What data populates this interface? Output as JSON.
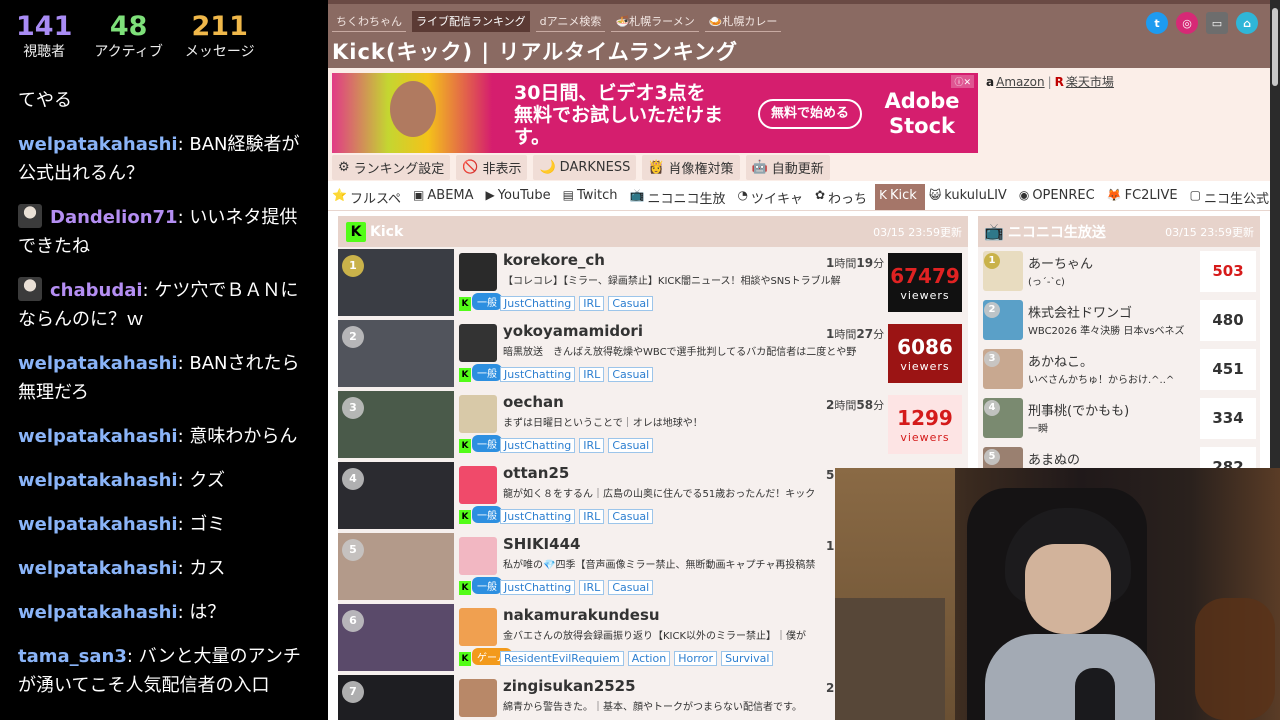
{
  "stream_stats": {
    "viewers": {
      "value": "141",
      "label": "視聴者"
    },
    "active": {
      "value": "48",
      "label": "アクティブ"
    },
    "messages": {
      "value": "211",
      "label": "メッセージ"
    }
  },
  "chat_messages": [
    {
      "user": "",
      "text": "てやる",
      "user_color": "#ffffff",
      "avatar": false
    },
    {
      "user": "welpatakahashi",
      "text": ": BAN経験者が公式出れるん？",
      "user_color": "#8ab4f8",
      "avatar": false
    },
    {
      "user": "Dandelion71",
      "text": ": いいネタ提供できたね",
      "user_color": "#b48ef2",
      "avatar": true
    },
    {
      "user": "chabudai",
      "text": ": ケツ穴でＢＡＮにならんのに？ｗ",
      "user_color": "#b48ef2",
      "avatar": true
    },
    {
      "user": "welpatakahashi",
      "text": ": BANされたら無理だろ",
      "user_color": "#8ab4f8",
      "avatar": false
    },
    {
      "user": "welpatakahashi",
      "text": ": 意味わからん",
      "user_color": "#8ab4f8",
      "avatar": false
    },
    {
      "user": "welpatakahashi",
      "text": ": クズ",
      "user_color": "#8ab4f8",
      "avatar": false
    },
    {
      "user": "welpatakahashi",
      "text": ": ゴミ",
      "user_color": "#8ab4f8",
      "avatar": false
    },
    {
      "user": "welpatakahashi",
      "text": ": カス",
      "user_color": "#8ab4f8",
      "avatar": false
    },
    {
      "user": "welpatakahashi",
      "text": ": は？",
      "user_color": "#8ab4f8",
      "avatar": false
    },
    {
      "user": "tama_san3",
      "text": ": バンと大量のアンチが湧いてこそ人気配信者の入口",
      "user_color": "#8ab4f8",
      "avatar": false
    }
  ],
  "site": {
    "top_links": [
      "ちくわちゃん",
      "ライブ配信ランキング",
      "dアニメ検索",
      "🍜札幌ラーメン",
      "🍛札幌カレー"
    ],
    "active_top_link": 1,
    "title": "Kick(キック) | リアルタイムランキング"
  },
  "ad": {
    "headline": "30日間、ビデオ3点を無料でお試しいただけます。",
    "button": "無料で始める",
    "brand": "Adobe Stock"
  },
  "shop_links": {
    "amazon": "Amazon",
    "separator": "|",
    "rakuten": "楽天市場"
  },
  "toolbar": [
    {
      "icon": "⚙",
      "label": "ランキング設定",
      "icon_name": "gear-icon"
    },
    {
      "icon": "🚫",
      "label": "非表示",
      "icon_name": "prohibited-icon"
    },
    {
      "icon": "🌙",
      "label": "DARKNESS",
      "icon_name": "moon-icon"
    },
    {
      "icon": "👸",
      "label": "肖像権対策",
      "icon_name": "portrait-icon"
    },
    {
      "icon": "🤖",
      "label": "自動更新",
      "icon_name": "robot-icon"
    }
  ],
  "platform_tabs": [
    {
      "icon": "⭐",
      "label": "フルスペ"
    },
    {
      "icon": "▣",
      "label": "ABEMA"
    },
    {
      "icon": "▶",
      "label": "YouTube"
    },
    {
      "icon": "▤",
      "label": "Twitch"
    },
    {
      "icon": "📺",
      "label": "ニコニコ生放"
    },
    {
      "icon": "◔",
      "label": "ツイキャ"
    },
    {
      "icon": "✿",
      "label": "わっち"
    },
    {
      "icon": "K",
      "label": "Kick"
    },
    {
      "icon": "😺",
      "label": "kukuluLIV"
    },
    {
      "icon": "◉",
      "label": "OPENREC"
    },
    {
      "icon": "🦊",
      "label": "FC2LIVE"
    },
    {
      "icon": "▢",
      "label": "ニコ生公式"
    }
  ],
  "active_tab": 7,
  "kick_panel": {
    "title": "Kick",
    "updated": "03/15 23:59更新",
    "rows": [
      {
        "rank": "1",
        "name": "korekore_ch",
        "title": "【コレコレ】【ミラー、録画禁止】KICK闇ニュース！相談やSNSトラブル解",
        "duration_h": "1",
        "duration_label_h": "時間",
        "duration_m": "19",
        "duration_label_m": "分",
        "category": "一般",
        "tags": [
          "JustChatting",
          "IRL",
          "Casual"
        ],
        "viewers": "67479",
        "viewer_label": "viewers"
      },
      {
        "rank": "2",
        "name": "yokoyamamidori",
        "title": "暗黒放送　きんばえ放得乾燥やWBCで選手批判してるバカ配信者は二度とや野",
        "duration_h": "1",
        "duration_label_h": "時間",
        "duration_m": "27",
        "duration_label_m": "分",
        "category": "一般",
        "tags": [
          "JustChatting",
          "IRL",
          "Casual"
        ],
        "viewers": "6086",
        "viewer_label": "viewers"
      },
      {
        "rank": "3",
        "name": "oechan",
        "title": "まずは日曜日ということで｜オレは地球や！",
        "duration_h": "2",
        "duration_label_h": "時間",
        "duration_m": "58",
        "duration_label_m": "分",
        "category": "一般",
        "tags": [
          "JustChatting",
          "IRL",
          "Casual"
        ],
        "viewers": "1299",
        "viewer_label": "viewers"
      },
      {
        "rank": "4",
        "name": "ottan25",
        "title": "龍が如く８をするん｜広島の山奥に住んでる51歳おったんだ！キック",
        "duration_h": "5",
        "duration_label_h": "",
        "duration_m": "",
        "duration_label_m": "",
        "category": "一般",
        "tags": [
          "JustChatting",
          "IRL",
          "Casual"
        ],
        "viewers": "",
        "viewer_label": ""
      },
      {
        "rank": "5",
        "name": "SHIKI444",
        "title": "私が唯の💎四季【音声画像ミラー禁止、無断動画キャプチャ再投稿禁",
        "duration_h": "1",
        "duration_label_h": "",
        "duration_m": "",
        "duration_label_m": "",
        "category": "一般",
        "tags": [
          "JustChatting",
          "IRL",
          "Casual"
        ],
        "viewers": "",
        "viewer_label": ""
      },
      {
        "rank": "6",
        "name": "nakamurakundesu",
        "title": "金バエさんの放得会録画振り返り【KICK以外のミラー禁止】｜僕が",
        "duration_h": "",
        "duration_label_h": "",
        "duration_m": "",
        "duration_label_m": "",
        "category": "ゲーム",
        "tags": [
          "ResidentEvilRequiem",
          "Action",
          "Horror",
          "Survival"
        ],
        "viewers": "",
        "viewer_label": ""
      },
      {
        "rank": "7",
        "name": "zingisukan2525",
        "title": "綿青から警告きた。｜基本、顔やトークがつまらない配信者です。",
        "duration_h": "2",
        "duration_label_h": "",
        "duration_m": "",
        "duration_label_m": "",
        "category": "",
        "tags": [],
        "viewers": "",
        "viewer_label": ""
      }
    ]
  },
  "nico_panel": {
    "title": "ニコニコ生放送",
    "updated": "03/15 23:59更新",
    "rows": [
      {
        "rank": "1",
        "name": "あーちゃん",
        "sub": "(っ´-`c)",
        "count": "503"
      },
      {
        "rank": "2",
        "name": "株式会社ドワンゴ",
        "sub": "WBC2026 準々決勝 日本vsベネズ",
        "count": "480"
      },
      {
        "rank": "3",
        "name": "あかねこ。",
        "sub": "いべさんかちゅ！からおけ.^..^",
        "count": "451"
      },
      {
        "rank": "4",
        "name": "刑事桃(でかもも)",
        "sub": "一瞬",
        "count": "334"
      },
      {
        "rank": "5",
        "name": "あまぬの",
        "sub": "",
        "count": "282"
      }
    ]
  },
  "colors": {
    "header_bg": "#8a6a62",
    "kick_green": "#53fc18",
    "viewer_top1": "#111111",
    "viewer_top2": "#9b1414",
    "viewer_top3_text": "#d41a1a",
    "nico_top": "#d61a1a"
  }
}
